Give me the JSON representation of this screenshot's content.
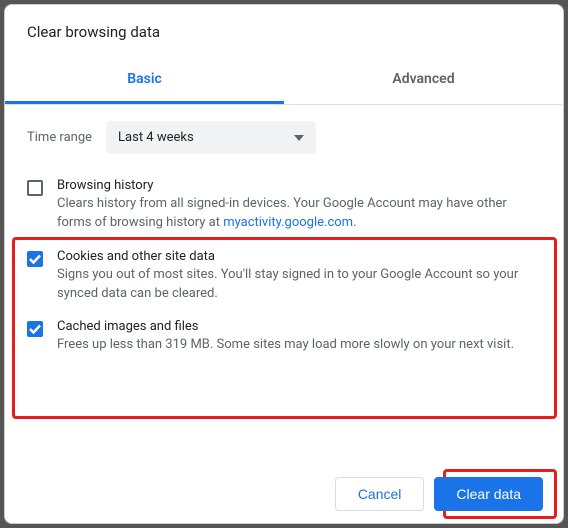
{
  "title": "Clear browsing data",
  "tabs": {
    "basic": "Basic",
    "advanced": "Advanced"
  },
  "time": {
    "label": "Time range",
    "value": "Last 4 weeks"
  },
  "options": {
    "history": {
      "title": "Browsing history",
      "desc_pre": "Clears history from all signed-in devices. Your Google Account may have other forms of browsing history at ",
      "link": "myactivity.google.com",
      "desc_post": "."
    },
    "cookies": {
      "title": "Cookies and other site data",
      "desc": "Signs you out of most sites. You'll stay signed in to your Google Account so your synced data can be cleared."
    },
    "cache": {
      "title": "Cached images and files",
      "desc": "Frees up less than 319 MB. Some sites may load more slowly on your next visit."
    }
  },
  "buttons": {
    "cancel": "Cancel",
    "clear": "Clear data"
  }
}
